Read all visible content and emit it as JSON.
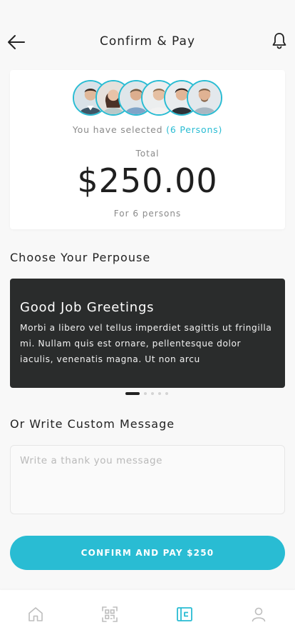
{
  "header": {
    "title": "Confirm & Pay",
    "back_icon": "arrow-left-icon",
    "notification_icon": "bell-icon"
  },
  "summary": {
    "selected_prefix": "You have selected",
    "selected_count": "(6 Persons)",
    "total_label": "Total",
    "amount": "$250.00",
    "for_persons": "For 6 persons",
    "avatars": [
      {
        "name": "avatar-1"
      },
      {
        "name": "avatar-2"
      },
      {
        "name": "avatar-3"
      },
      {
        "name": "avatar-4"
      },
      {
        "name": "avatar-5"
      },
      {
        "name": "avatar-6"
      }
    ]
  },
  "purpose": {
    "section_title": "Choose Your Perpouse",
    "card_title": "Good Job Greetings",
    "card_body": "Morbi a libero vel tellus imperdiet sagittis ut fringilla mi. Nullam quis est ornare, pellentesque dolor iaculis, venenatis magna. Ut non arcu",
    "carousel_total": 5,
    "carousel_active": 1
  },
  "custom_message": {
    "section_title": "Or Write Custom Message",
    "placeholder": "Write a thank you message",
    "value": ""
  },
  "confirm_button": "CONFIRM AND PAY $250",
  "tabbar": {
    "items": [
      {
        "icon": "home-icon",
        "active": false
      },
      {
        "icon": "qr-scan-icon",
        "active": false
      },
      {
        "icon": "wallet-icon",
        "active": true
      },
      {
        "icon": "profile-icon",
        "active": false
      }
    ]
  },
  "colors": {
    "accent": "#29bcd3",
    "card_dark": "#2a2c2c",
    "background": "#f8f8f8"
  }
}
